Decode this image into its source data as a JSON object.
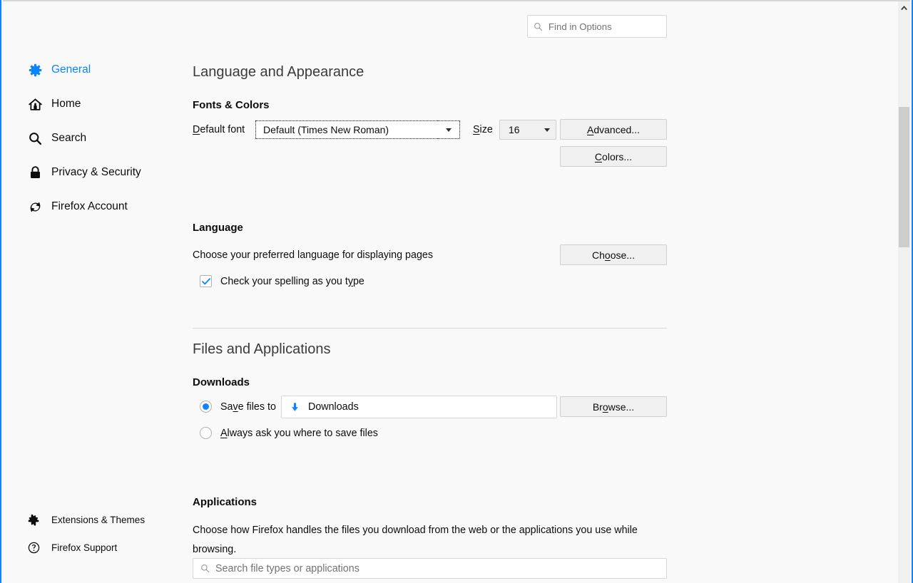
{
  "search": {
    "placeholder": "Find in Options",
    "icon": "search-icon"
  },
  "sidebar": {
    "items": [
      {
        "label": "General",
        "icon": "gear-icon",
        "active": true
      },
      {
        "label": "Home",
        "icon": "home-icon",
        "active": false
      },
      {
        "label": "Search",
        "icon": "search-icon",
        "active": false
      },
      {
        "label": "Privacy & Security",
        "icon": "lock-icon",
        "active": false
      },
      {
        "label": "Firefox Account",
        "icon": "sync-icon",
        "active": false
      }
    ],
    "bottom_items": [
      {
        "label": "Extensions & Themes",
        "icon": "puzzle-piece-icon"
      },
      {
        "label": "Firefox Support",
        "icon": "question-circle-icon"
      }
    ]
  },
  "main": {
    "language_appearance": {
      "title": "Language and Appearance",
      "fonts_colors": {
        "title": "Fonts & Colors",
        "default_font_label_pre": "D",
        "default_font_label_post": "efault font",
        "default_font_value": "Default (Times New Roman)",
        "size_label_pre": "S",
        "size_label_post": "ize",
        "size_value": "16",
        "advanced_button_pre": "A",
        "advanced_button_post": "dvanced...",
        "colors_button_pre": "C",
        "colors_button_post": "olors..."
      },
      "language": {
        "title": "Language",
        "description": "Choose your preferred language for displaying pages",
        "choose_button_pre": "Ch",
        "choose_button_mid": "o",
        "choose_button_post": "ose...",
        "spellcheck_label_pre": "Check your spelling as you t",
        "spellcheck_label_mid": "y",
        "spellcheck_label_post": "pe",
        "spellcheck_checked": true
      }
    },
    "files_applications": {
      "title": "Files and Applications",
      "downloads": {
        "title": "Downloads",
        "save_files_to_label_pre": "Sa",
        "save_files_to_label_mid": "v",
        "save_files_to_label_post": "e files to",
        "save_files_to_selected": true,
        "download_path": "Downloads",
        "download_icon": "download-arrow-icon",
        "browse_button_pre": "Br",
        "browse_button_mid": "o",
        "browse_button_post": "wse...",
        "always_ask_label_pre": "A",
        "always_ask_label_mid": "l",
        "always_ask_label_post": "ways ask you where to save files",
        "always_ask_selected": false
      },
      "applications": {
        "title": "Applications",
        "description": "Choose how Firefox handles the files you download from the web or the applications you use while browsing.",
        "search_placeholder": "Search file types or applications",
        "search_icon": "search-icon"
      }
    }
  },
  "scrollbar": {
    "up_arrow_icon": "chevron-up-icon"
  },
  "colors": {
    "accent": "#0a84ff",
    "background": "#f9f9fa",
    "text": "#0c0c0d",
    "muted_text": "#737373",
    "border": "#d7d7db",
    "scroll_thumb": "#cdcdcd"
  }
}
